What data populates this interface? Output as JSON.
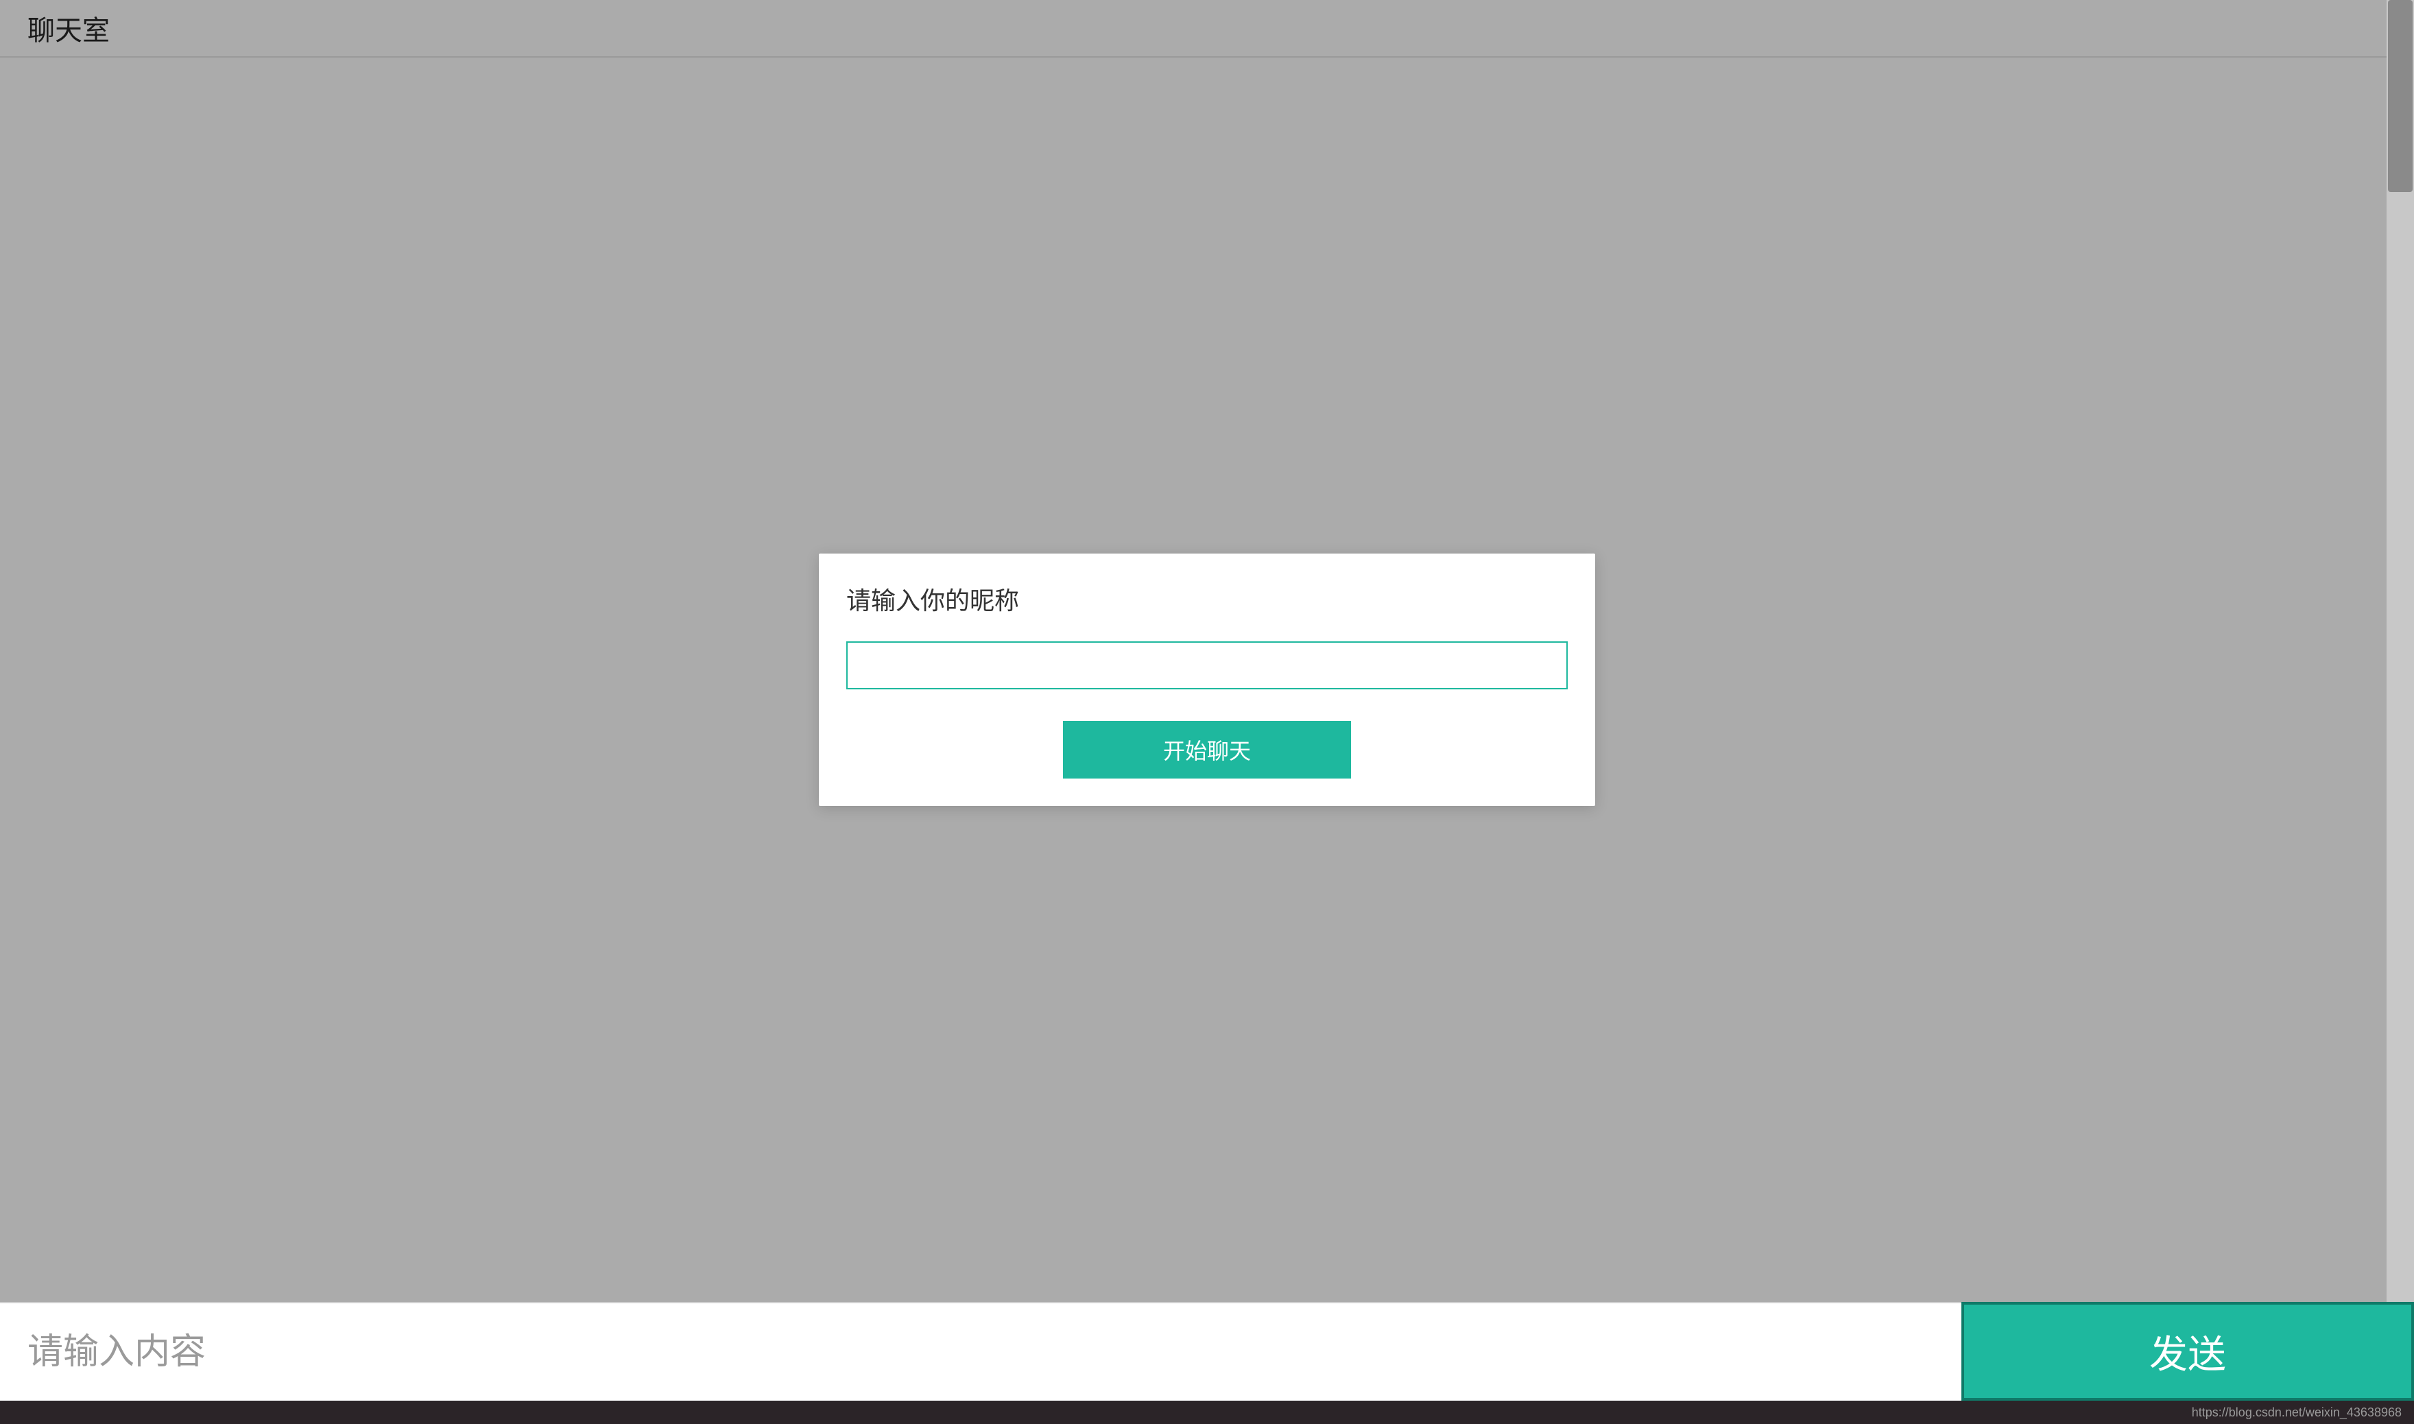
{
  "header": {
    "title": "聊天室"
  },
  "modal": {
    "title": "请输入你的昵称",
    "nickname_value": "",
    "start_button_label": "开始聊天"
  },
  "footer": {
    "message_placeholder": "请输入内容",
    "message_value": "",
    "send_button_label": "发送"
  },
  "watermark": {
    "text": "https://blog.csdn.net/weixin_43638968"
  },
  "colors": {
    "accent": "#1eb89e",
    "background": "#ababab",
    "modal_bg": "#ffffff",
    "bottom_bar": "#2b2428"
  }
}
